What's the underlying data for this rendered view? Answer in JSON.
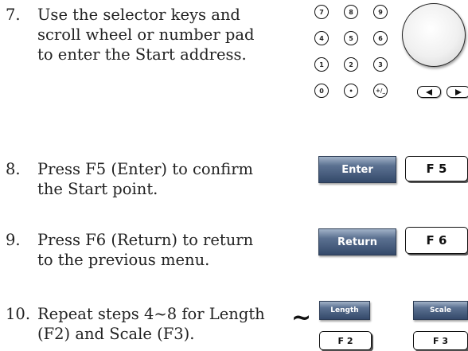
{
  "steps": [
    {
      "num": "7.",
      "lines": [
        "Use the selector keys and",
        "scroll wheel or number pad",
        "to enter the Start address."
      ]
    },
    {
      "num": "8.",
      "lines": [
        "Press F5 (Enter) to confirm",
        "the Start point."
      ]
    },
    {
      "num": "9.",
      "lines": [
        "Press F6 (Return) to return",
        "to the previous menu."
      ]
    },
    {
      "num": "10.",
      "lines": [
        "Repeat steps 4~8 for Length",
        "(F2) and Scale (F3)."
      ]
    }
  ],
  "keypad": {
    "rows": [
      [
        "7",
        "8",
        "9"
      ],
      [
        "4",
        "5",
        "6"
      ],
      [
        "1",
        "2",
        "3"
      ],
      [
        "0",
        "•",
        "+/_"
      ]
    ]
  },
  "buttons": {
    "enter": {
      "label": "Enter",
      "fkey": "F 5"
    },
    "return": {
      "label": "Return",
      "fkey": "F 6"
    },
    "length": {
      "label": "Length",
      "fkey": "F 2"
    },
    "scale": {
      "label": "Scale",
      "fkey": "F 3"
    },
    "range_symbol": "~"
  }
}
